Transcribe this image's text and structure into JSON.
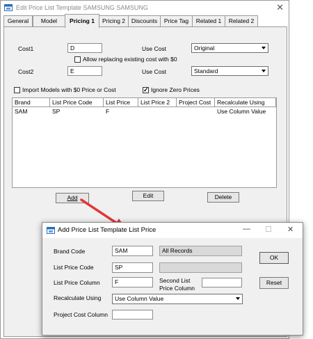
{
  "main": {
    "title": "Edit Price List Template SAMSUNG SAMSUNG",
    "close_glyph": "✕",
    "tabs": [
      "General",
      "Model",
      "Pricing 1",
      "Pricing 2",
      "Discounts",
      "Price Tag",
      "Related 1",
      "Related 2"
    ],
    "active_tab": "Pricing 1",
    "cost1": {
      "label": "Cost1",
      "value": "D",
      "use_cost_label": "Use Cost",
      "use_cost_value": "Original"
    },
    "allow_replacing": {
      "label": "Allow replacing existing cost with $0",
      "checked": false
    },
    "cost2": {
      "label": "Cost2",
      "value": "E",
      "use_cost_label": "Use Cost",
      "use_cost_value": "Standard"
    },
    "import_models": {
      "label": "Import Models with $0 Price or Cost",
      "checked": false
    },
    "ignore_zero": {
      "label": "Ignore Zero Prices",
      "checked": true,
      "check_glyph": "✓"
    },
    "grid": {
      "columns": [
        "Brand",
        "List Price Code",
        "List Price",
        "List Price 2",
        "Project Cost",
        "Recalculate Using"
      ],
      "rows": [
        [
          "SAM",
          "SP",
          "F",
          "",
          "",
          "Use Column Value"
        ]
      ]
    },
    "buttons": {
      "add": "Add",
      "edit": "Edit",
      "delete": "Delete"
    }
  },
  "dialog": {
    "title": "Add Price List Template List Price",
    "minimize_glyph": "—",
    "maximize_glyph": "☐",
    "close_glyph": "✕",
    "brand_code": {
      "label": "Brand Code",
      "value": "SAM",
      "desc": "All Records"
    },
    "list_price_code": {
      "label": "List Price Code",
      "value": "SP",
      "desc": ""
    },
    "list_price_column": {
      "label": "List Price Column",
      "value": "F"
    },
    "second_list": {
      "label_line1": "Second List",
      "label_line2": "Price Column",
      "value": ""
    },
    "recalculate": {
      "label": "Recalculate Using",
      "value": "Use Column Value"
    },
    "project_cost": {
      "label": "Project Cost Column",
      "value": ""
    },
    "buttons": {
      "ok": "OK",
      "reset": "Reset"
    }
  },
  "colors": {
    "arrow": "#e0383a",
    "window_bg": "#f0f0f0",
    "title_text_inactive": "#8a8a8a"
  }
}
